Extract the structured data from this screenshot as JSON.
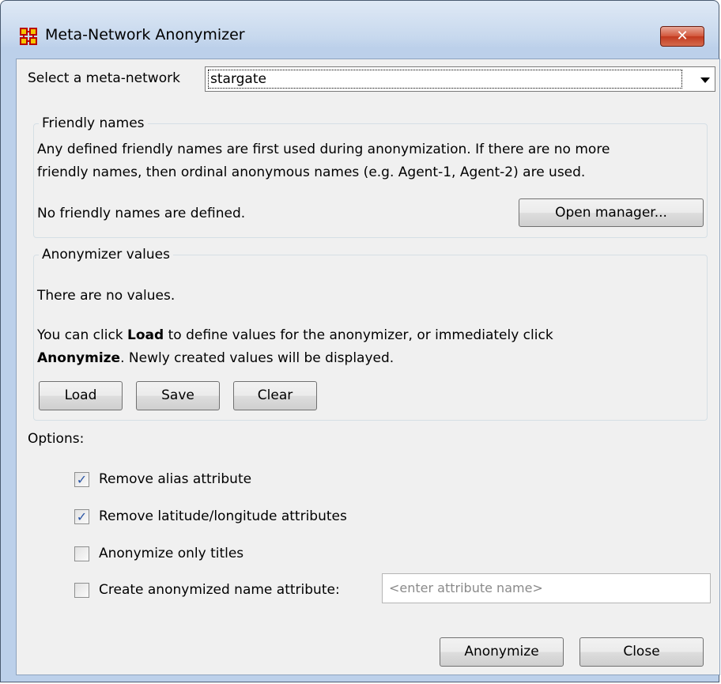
{
  "window": {
    "title": "Meta-Network Anonymizer",
    "close_label": "✕"
  },
  "meta_network": {
    "label": "Select a meta-network",
    "selected": "stargate"
  },
  "friendly_names": {
    "group_title": "Friendly names",
    "description_line1": "Any defined friendly names are first used during anonymization. If there are no more",
    "description_line2": "friendly names, then ordinal anonymous names (e.g. Agent-1, Agent-2) are used.",
    "status": "No friendly names are defined.",
    "open_manager_label": "Open manager..."
  },
  "anonymizer_values": {
    "group_title": "Anonymizer values",
    "status": "There are no values.",
    "help_pre": "You can click ",
    "help_load": "Load",
    "help_mid": " to define values for the anonymizer, or immediately click",
    "help_anonymize": "Anonymize",
    "help_post": ". Newly created values will be displayed.",
    "load_label": "Load",
    "save_label": "Save",
    "clear_label": "Clear"
  },
  "options": {
    "label": "Options:",
    "items": [
      {
        "label": "Remove alias attribute",
        "checked": true
      },
      {
        "label": "Remove latitude/longitude attributes",
        "checked": true
      },
      {
        "label": "Anonymize only titles",
        "checked": false
      },
      {
        "label": "Create anonymized name attribute:",
        "checked": false
      }
    ],
    "attribute_placeholder": "<enter attribute name>"
  },
  "footer": {
    "anonymize_label": "Anonymize",
    "close_label": "Close"
  },
  "colors": {
    "title_bar": "#c8d9ee",
    "close_button": "#c23a1f",
    "dialog_background": "#f0f0f0",
    "check_mark": "#2a55a5"
  }
}
